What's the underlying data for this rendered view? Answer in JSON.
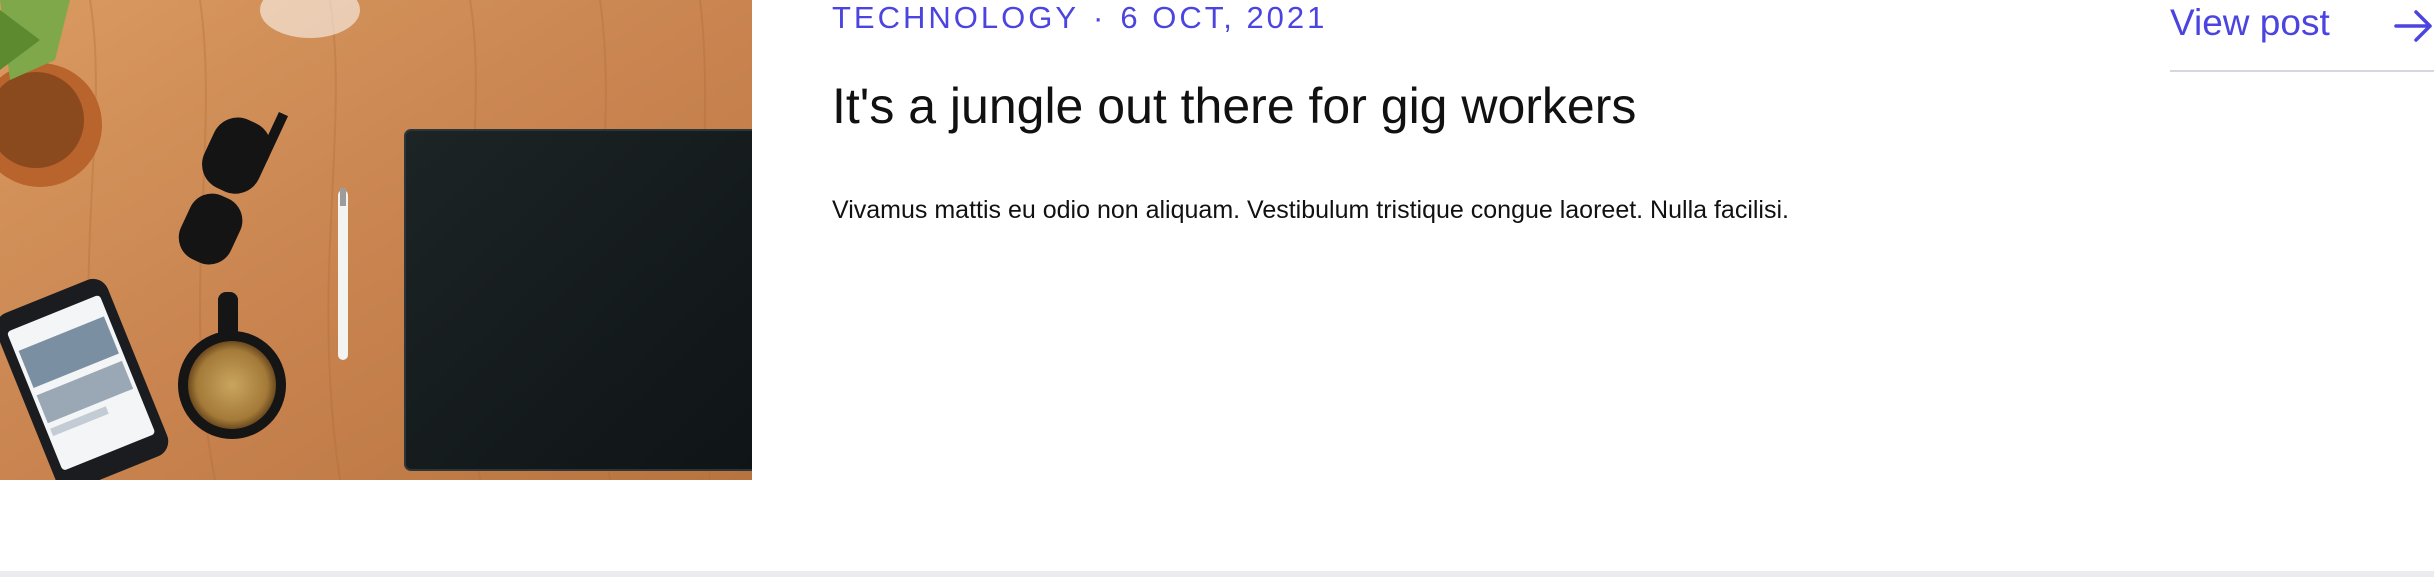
{
  "post": {
    "category": "TECHNOLOGY",
    "separator": "·",
    "date": "6 OCT, 2021",
    "title": "It's a jungle out there for gig workers",
    "excerpt": "Vivamus mattis eu odio non aliquam. Vestibulum tristique congue laoreet. Nulla facilisi.",
    "view_label": "View post"
  },
  "icons": {
    "view_post": "arrow-right-icon"
  },
  "colors": {
    "accent": "#4b44e0",
    "text": "#111111",
    "divider": "#d7d7de",
    "wood": "#c98a53"
  }
}
